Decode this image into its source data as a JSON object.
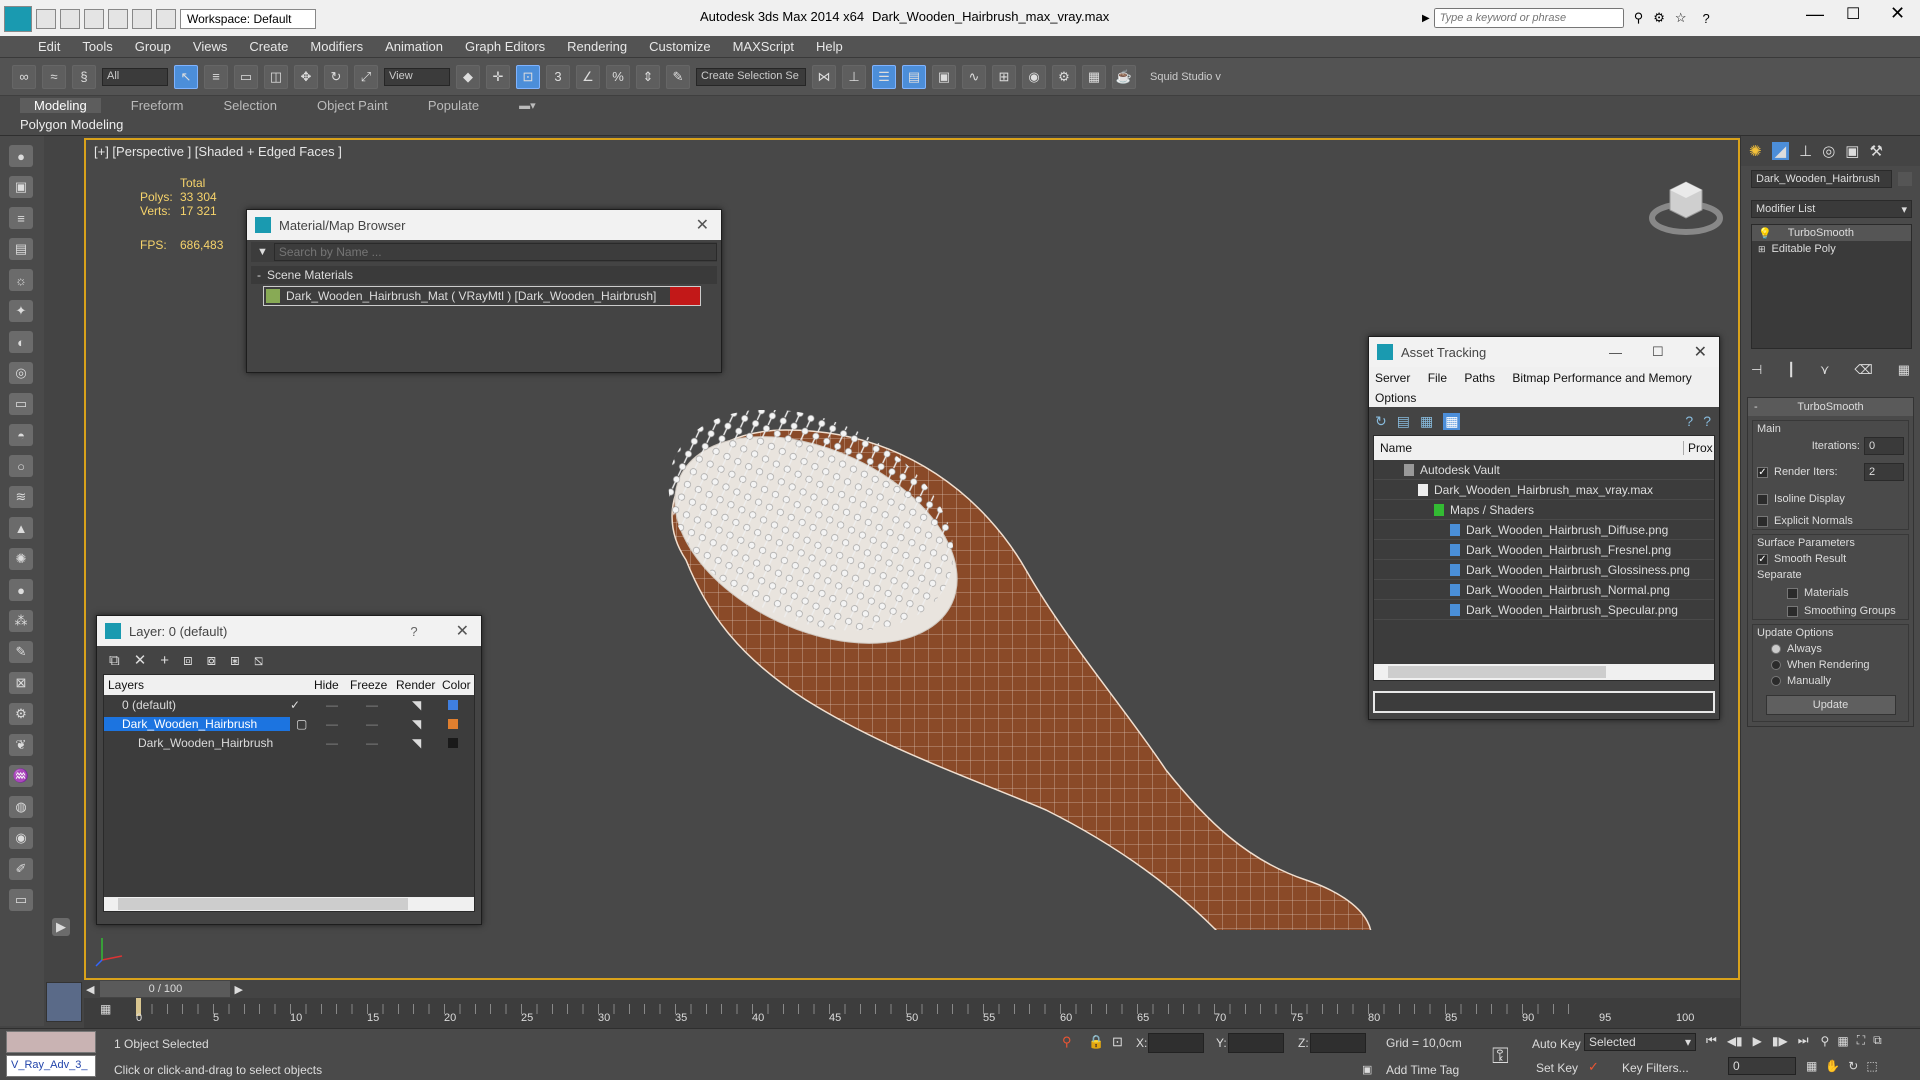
{
  "titlebar": {
    "workspace": "Workspace: Default",
    "app_title": "Autodesk 3ds Max  2014 x64",
    "file_title": "Dark_Wooden_Hairbrush_max_vray.max",
    "search_placeholder": "Type a keyword or phrase"
  },
  "menu": [
    "Edit",
    "Tools",
    "Group",
    "Views",
    "Create",
    "Modifiers",
    "Animation",
    "Graph Editors",
    "Rendering",
    "Customize",
    "MAXScript",
    "Help"
  ],
  "toolbar": {
    "filter_value": "All",
    "refcoord_value": "View",
    "selection_set_placeholder": "Create Selection Se",
    "squid_label": "Squid Studio v"
  },
  "ribbon": {
    "tabs": [
      "Modeling",
      "Freeform",
      "Selection",
      "Object Paint",
      "Populate"
    ],
    "sub": "Polygon Modeling"
  },
  "viewport": {
    "label": "[+] [Perspective ] [Shaded + Edged Faces ]",
    "stats": {
      "total_label": "Total",
      "polys_label": "Polys:",
      "polys_value": "33 304",
      "verts_label": "Verts:",
      "verts_value": "17 321",
      "fps_label": "FPS:",
      "fps_value": "686,483"
    }
  },
  "material_browser": {
    "title": "Material/Map Browser",
    "search_placeholder": "Search by Name ...",
    "section": "Scene Materials",
    "item": "Dark_Wooden_Hairbrush_Mat  ( VRayMtl ) [Dark_Wooden_Hairbrush]"
  },
  "layer_window": {
    "title": "Layer: 0 (default)",
    "help": "?",
    "columns": [
      "Layers",
      "Hide",
      "Freeze",
      "Render",
      "Color"
    ],
    "rows": [
      {
        "name": "0 (default)",
        "color": "#3f7fe0"
      },
      {
        "name": "Dark_Wooden_Hairbrush",
        "color": "#e07f2f"
      },
      {
        "name": "Dark_Wooden_Hairbrush",
        "color": "#1a1a1a"
      }
    ]
  },
  "asset_tracking": {
    "title": "Asset Tracking",
    "menu": [
      "Server",
      "File",
      "Paths",
      "Bitmap Performance and Memory"
    ],
    "menu2": "Options",
    "columns": [
      "Name",
      "Prox"
    ],
    "rows": [
      "Autodesk Vault",
      "Dark_Wooden_Hairbrush_max_vray.max",
      "Maps / Shaders",
      "Dark_Wooden_Hairbrush_Diffuse.png",
      "Dark_Wooden_Hairbrush_Fresnel.png",
      "Dark_Wooden_Hairbrush_Glossiness.png",
      "Dark_Wooden_Hairbrush_Normal.png",
      "Dark_Wooden_Hairbrush_Specular.png"
    ]
  },
  "command_panel": {
    "object_name": "Dark_Wooden_Hairbrush",
    "modifier_list": "Modifier List",
    "stack": [
      "TurboSmooth",
      "Editable Poly"
    ],
    "rollout_title": "TurboSmooth",
    "main_label": "Main",
    "iterations_label": "Iterations:",
    "iterations_value": "0",
    "render_iters_label": "Render Iters:",
    "render_iters_value": "2",
    "isoline": "Isoline Display",
    "explicit": "Explicit Normals",
    "surface_label": "Surface Parameters",
    "smooth_result": "Smooth Result",
    "separate_label": "Separate",
    "materials": "Materials",
    "smoothing_groups": "Smoothing Groups",
    "update_label": "Update Options",
    "always": "Always",
    "when_rendering": "When Rendering",
    "manually": "Manually",
    "update_button": "Update"
  },
  "timeline": {
    "frame": "0 / 100",
    "ticks": [
      "0",
      "5",
      "10",
      "15",
      "20",
      "25",
      "30",
      "35",
      "40",
      "45",
      "50",
      "55",
      "60",
      "65",
      "70",
      "75",
      "80",
      "85",
      "90",
      "95",
      "100"
    ]
  },
  "status": {
    "script_label": "V_Ray_Adv_3_",
    "selected": "1 Object Selected",
    "prompt": "Click or click-and-drag to select objects",
    "x_label": "X:",
    "y_label": "Y:",
    "z_label": "Z:",
    "grid": "Grid = 10,0cm",
    "add_time_tag": "Add Time Tag",
    "auto_key": "Auto Key",
    "auto_key_value": "Selected",
    "set_key": "Set Key",
    "key_filters": "Key Filters...",
    "frame_value": "0"
  }
}
